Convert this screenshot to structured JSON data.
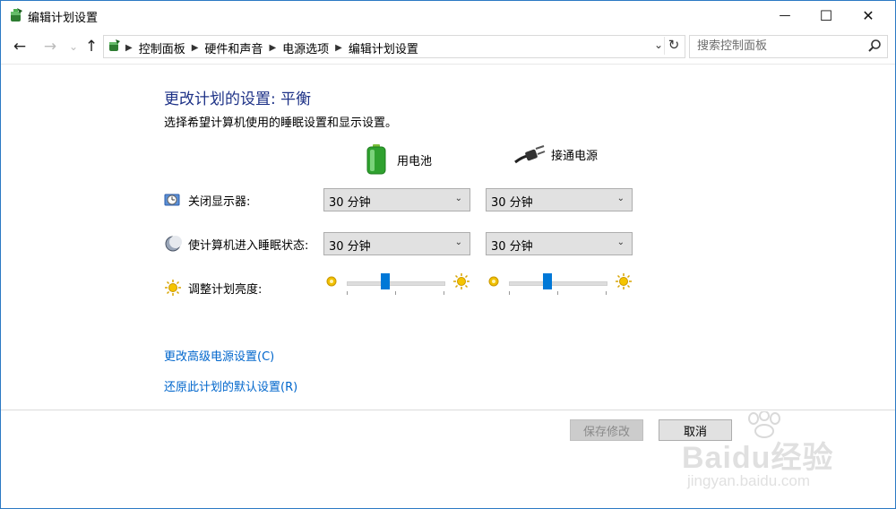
{
  "window": {
    "title": "编辑计划设置",
    "minimize_glyph": "—",
    "maximize_glyph": "☐",
    "close_glyph": "✕"
  },
  "nav": {
    "back_glyph": "←",
    "forward_glyph": "→",
    "recent_glyph": "⌄",
    "up_glyph": "↑"
  },
  "breadcrumbs": [
    "控制面板",
    "硬件和声音",
    "电源选项",
    "编辑计划设置"
  ],
  "address": {
    "dropdown_glyph": "⌄",
    "refresh_glyph": "↻"
  },
  "search": {
    "placeholder": "搜索控制面板"
  },
  "content": {
    "heading": "更改计划的设置: 平衡",
    "subtext": "选择希望计算机使用的睡眠设置和显示设置。",
    "columns": {
      "battery": "用电池",
      "plugged": "接通电源"
    },
    "rows": {
      "display_off": {
        "label": "关闭显示器:",
        "battery_value": "30 分钟",
        "plugged_value": "30 分钟"
      },
      "sleep": {
        "label": "使计算机进入睡眠状态:",
        "battery_value": "30 分钟",
        "plugged_value": "30 分钟"
      },
      "brightness": {
        "label": "调整计划亮度:",
        "battery_level": 0.4,
        "plugged_level": 0.4
      }
    },
    "links": {
      "advanced": "更改高级电源设置(C)",
      "restore": "还原此计划的默认设置(R)"
    }
  },
  "buttons": {
    "save": "保存修改",
    "cancel": "取消"
  },
  "watermark": {
    "brand_text": "Baidu经验",
    "url_text": "jingyan.baidu.com"
  },
  "colors": {
    "heading": "#1e3287",
    "link": "#0066cc",
    "slider_thumb": "#0078d7",
    "window_border": "#2b79c4"
  }
}
